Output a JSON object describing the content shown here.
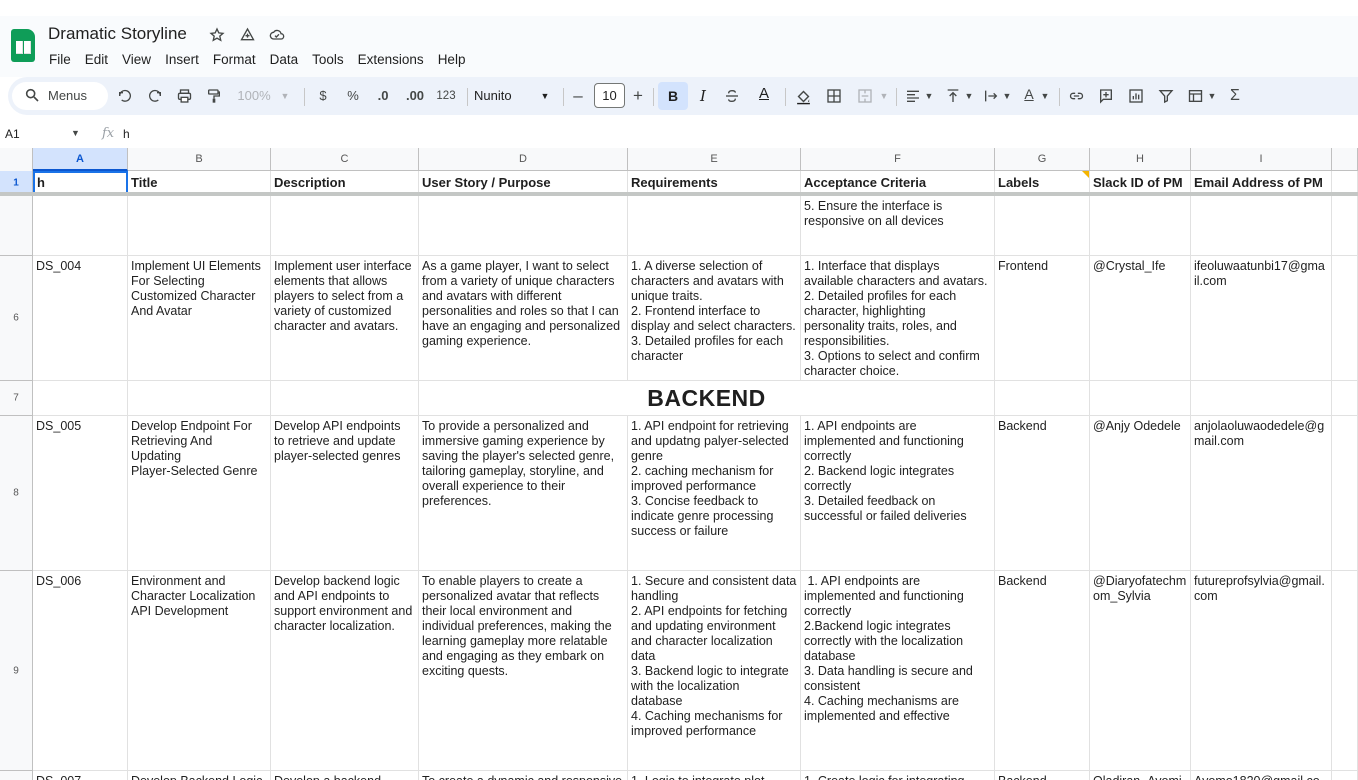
{
  "document": {
    "title": "Dramatic Storyline"
  },
  "menu": [
    "File",
    "Edit",
    "View",
    "Insert",
    "Format",
    "Data",
    "Tools",
    "Extensions",
    "Help"
  ],
  "toolbar": {
    "search_label": "Menus",
    "zoom": "100%",
    "currency": "$",
    "percent": "%",
    "decrease_decimal": ".0",
    "increase_decimal": ".00",
    "number_format": "123",
    "font_family": "Nunito",
    "font_size": "10",
    "bold": "B",
    "italic": "I",
    "text_color_glyph": "A",
    "text_rotation_glyph": "A",
    "function_glyph": "Σ"
  },
  "formula_bar": {
    "cell_ref": "A1",
    "fx": "fx",
    "value": "h"
  },
  "columns": [
    "A",
    "B",
    "C",
    "D",
    "E",
    "F",
    "G",
    "H",
    "I"
  ],
  "header_row": {
    "number": "1",
    "cells": [
      "h",
      "Title",
      "Description",
      "User Story / Purpose",
      "Requirements",
      "Acceptance Criteria",
      "Labels",
      "Slack ID of PM",
      "Email Address of PM"
    ]
  },
  "rows": [
    {
      "number": "",
      "cells": [
        "",
        "",
        "",
        "",
        "",
        "5. Ensure the interface is\nresponsive on all devices",
        "",
        "",
        ""
      ]
    },
    {
      "number": "6",
      "cells": [
        "DS_004",
        "Implement UI Elements\nFor Selecting\nCustomized Character\nAnd Avatar",
        "Implement user interface\nelements that allows\nplayers to select from a\nvariety of customized\ncharacter and avatars.",
        "As a game player, I want to select\nfrom a variety of unique characters\nand avatars with different\npersonalities and roles so that I can\nhave an engaging and personalized\ngaming experience.",
        "1. A diverse selection of\ncharacters and avatars with\nunique traits.\n2. Frontend interface to\ndisplay and select characters.\n3. Detailed profiles for each\ncharacter",
        "1. Interface that displays\navailable characters and avatars.\n2. Detailed profiles for each\ncharacter, highlighting\npersonality traits, roles, and\nresponsibilities.\n3. Options to select and confirm\ncharacter choice.",
        "Frontend",
        "@Crystal_Ife",
        "ifeoluwaatunbi17@gma\nil.com"
      ]
    },
    {
      "number": "7",
      "merged_text": "BACKEND",
      "cells": [
        "",
        "",
        "",
        "",
        "",
        "",
        "",
        "",
        ""
      ]
    },
    {
      "number": "8",
      "cells": [
        "DS_005",
        "Develop Endpoint For\nRetrieving And\nUpdating\nPlayer-Selected Genre",
        "Develop API endpoints\nto retrieve and update\nplayer-selected genres",
        "To provide a personalized and\nimmersive gaming experience by\nsaving the player's selected genre,\ntailoring gameplay, storyline, and\noverall experience to their\npreferences.",
        "1. API endpoint for retrieving\nand updatng palyer-selected\ngenre\n2. caching mechanism for\nimproved performance\n3. Concise feedback to\nindicate genre processing\nsuccess or failure",
        "1. API endpoints are\nimplemented and functioning\ncorrectly\n2. Backend logic integrates\ncorrectly\n3. Detailed feedback on\nsuccessful or failed deliveries",
        "Backend",
        "@Anjy Odedele",
        "anjolaoluwaodedele@g\nmail.com"
      ]
    },
    {
      "number": "9",
      "cells": [
        "DS_006",
        "Environment and\nCharacter Localization\nAPI Development",
        "Develop backend logic\nand API endpoints to\nsupport environment and\ncharacter localization.",
        "To enable players to create a\npersonalized avatar that reflects\ntheir local environment and\nindividual preferences, making the\nlearning gameplay more relatable\nand engaging as they embark on\nexciting quests.",
        "1. Secure and consistent data\nhandling\n2. API endpoints for fetching\nand updating environment\nand character localization\ndata\n3. Backend logic to integrate\nwith the localization\ndatabase\n4. Caching mechanisms for\nimproved performance",
        " 1. API endpoints are\nimplemented and functioning\ncorrectly\n2.Backend logic integrates\ncorrectly with the localization\ndatabase\n3. Data handling is secure and\nconsistent\n4. Caching mechanisms are\nimplemented and effective",
        "Backend",
        "@Diaryofatechm\nom_Sylvia",
        "futureprofsylvia@gmail.\ncom"
      ]
    },
    {
      "number": "",
      "cells": [
        "DS_007",
        "Develop Backend Logic",
        "Develop a backend",
        "To create a dynamic and responsive",
        "1. Logic to integrate plot",
        "1. Create logic for integrating",
        "Backend",
        "Oladiran_Ayomi",
        "Ayomo1820@gmail.co"
      ]
    }
  ],
  "colors": {
    "accent": "#1a73e8",
    "selection": "#d3e3fd",
    "sheets_green": "#0f9d58",
    "toolbar_bg": "#edf2fa",
    "note_marker": "#f4b400"
  },
  "icons": {
    "search": "search-icon",
    "star": "star-icon",
    "move": "move-to-drive-icon",
    "cloud": "cloud-status-icon"
  }
}
